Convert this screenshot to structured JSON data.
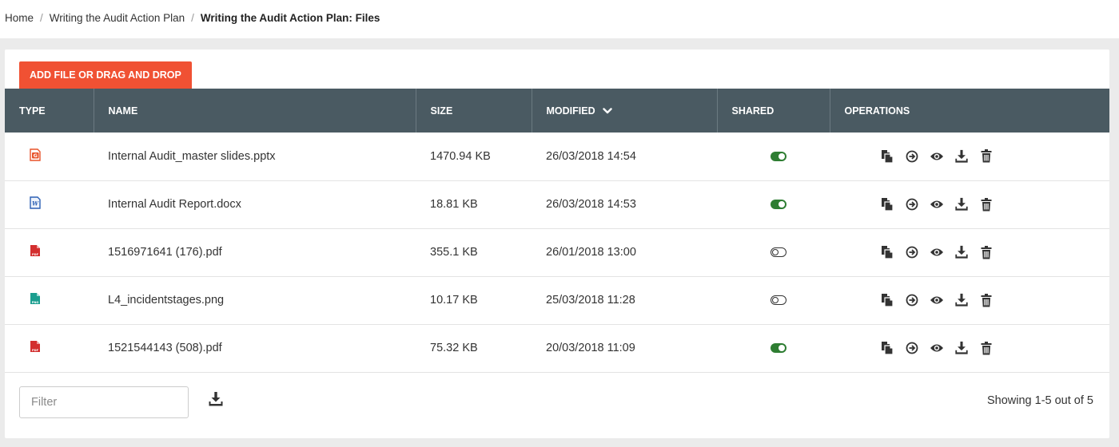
{
  "breadcrumb": {
    "items": [
      "Home",
      "Writing the Audit Action Plan"
    ],
    "current": "Writing the Audit Action Plan: Files",
    "separator": "/"
  },
  "toolbar": {
    "add_label": "ADD FILE OR DRAG AND DROP"
  },
  "table": {
    "headers": {
      "type": "TYPE",
      "name": "NAME",
      "size": "SIZE",
      "modified": "MODIFIED",
      "shared": "SHARED",
      "operations": "OPERATIONS"
    },
    "sort": {
      "column": "modified",
      "direction": "descending"
    },
    "rows": [
      {
        "type_icon": "powerpoint-file-icon",
        "type_color": "#e8532a",
        "name": "Internal Audit_master slides.pptx",
        "size": "1470.94 KB",
        "modified": "26/03/2018 14:54",
        "shared": true
      },
      {
        "type_icon": "word-file-icon",
        "type_color": "#2b5fb4",
        "name": "Internal Audit Report.docx",
        "size": "18.81 KB",
        "modified": "26/03/2018 14:53",
        "shared": true
      },
      {
        "type_icon": "pdf-file-icon",
        "type_color": "#d32f2f",
        "name": "1516971641 (176).pdf",
        "size": "355.1 KB",
        "modified": "26/01/2018 13:00",
        "shared": false
      },
      {
        "type_icon": "png-file-icon",
        "type_color": "#1a9e8f",
        "name": "L4_incidentstages.png",
        "size": "10.17 KB",
        "modified": "25/03/2018 11:28",
        "shared": false
      },
      {
        "type_icon": "pdf-file-icon",
        "type_color": "#d32f2f",
        "name": "1521544143 (508).pdf",
        "size": "75.32 KB",
        "modified": "20/03/2018 11:09",
        "shared": true
      }
    ],
    "operations": [
      "copy-icon",
      "move-icon",
      "view-icon",
      "download-icon",
      "delete-icon"
    ]
  },
  "footer": {
    "filter_placeholder": "Filter",
    "export_icon": "download-icon",
    "showing": "Showing 1-5 out of 5"
  },
  "colors": {
    "accent": "#f05133",
    "header_bg": "#4a5a62",
    "toggle_on": "#2e7d32",
    "page_bg": "#ebebeb"
  }
}
